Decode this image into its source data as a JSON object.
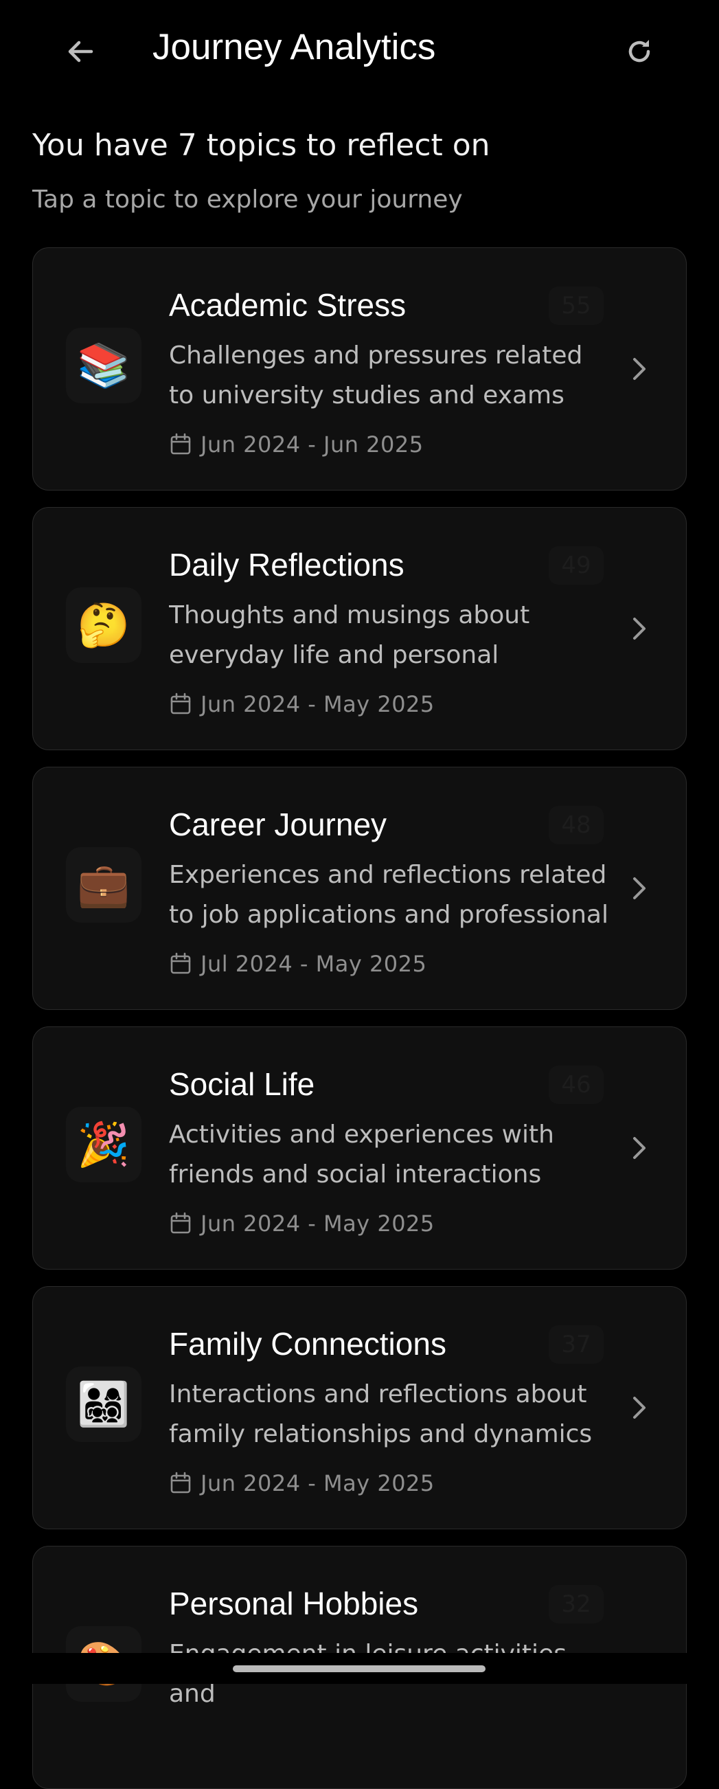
{
  "header": {
    "title": "Journey Analytics",
    "back_icon": "arrow-left-icon",
    "refresh_icon": "refresh-icon"
  },
  "summary": {
    "text": "You have 7 topics to reflect on",
    "hint": "Tap a topic to explore your journey"
  },
  "topics": [
    {
      "emoji": "📚",
      "title": "Academic Stress",
      "count": "55",
      "description": "Challenges and pressures related to university studies and exams",
      "date_range": "Jun 2024 - Jun 2025"
    },
    {
      "emoji": "🤔",
      "title": "Daily Reflections",
      "count": "49",
      "description": "Thoughts and musings about everyday life and personal",
      "date_range": "Jun 2024 - May 2025"
    },
    {
      "emoji": "💼",
      "title": "Career Journey",
      "count": "48",
      "description": "Experiences and reflections related to job applications and professional",
      "date_range": "Jul 2024 - May 2025"
    },
    {
      "emoji": "🎉",
      "title": "Social Life",
      "count": "46",
      "description": "Activities and experiences with friends and social interactions",
      "date_range": "Jun 2024 - May 2025"
    },
    {
      "emoji": "👨‍👩‍👧‍👦",
      "title": "Family Connections",
      "count": "37",
      "description": "Interactions and reflections about family relationships and dynamics",
      "date_range": "Jun 2024 - May 2025"
    },
    {
      "emoji": "🎨",
      "title": "Personal Hobbies",
      "count": "32",
      "description": "Engagement in leisure activities and",
      "date_range": ""
    }
  ],
  "colors": {
    "background": "#000000",
    "card_background": "#101010",
    "card_border": "#2a2a2a",
    "title_text": "#ffffff",
    "description_text": "#bdbdbd",
    "date_text": "#8f8f8f"
  }
}
